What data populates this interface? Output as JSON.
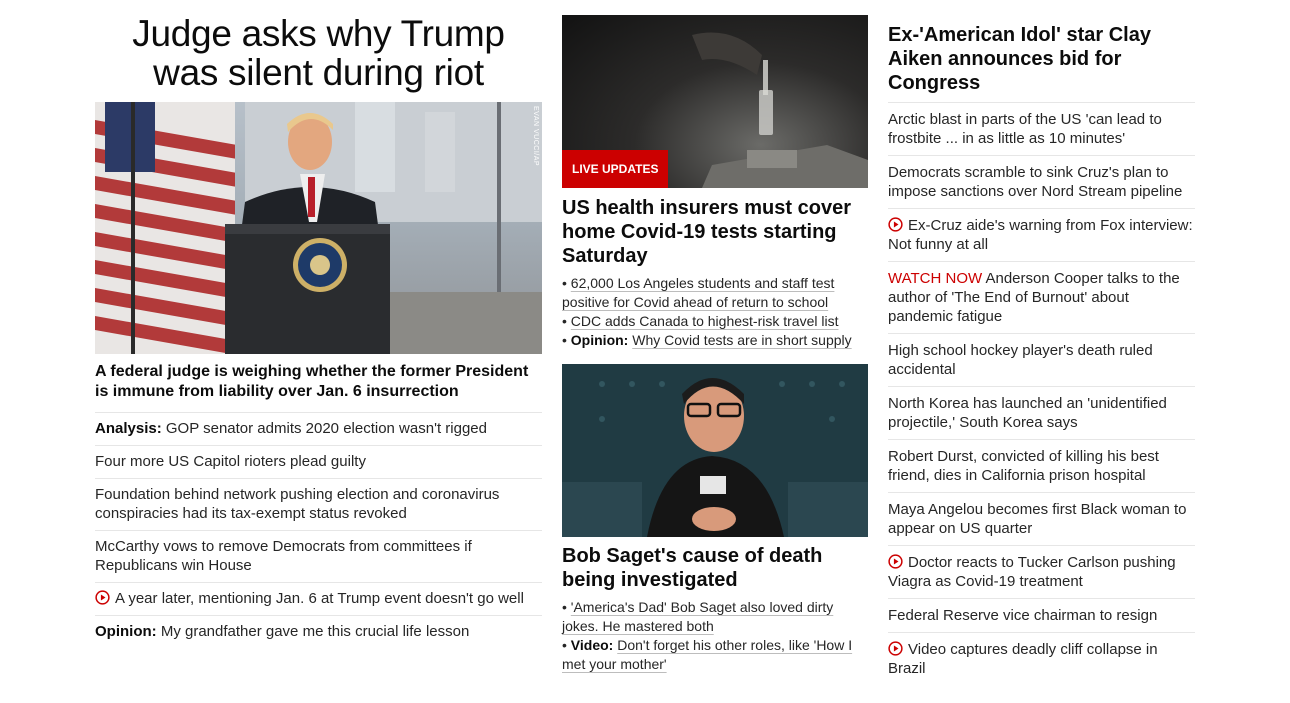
{
  "left": {
    "headline": "Judge asks why Trump was silent during riot",
    "image_credit": "EVAN VUCCI/AP",
    "subheadline": "A federal judge is weighing whether the former President is immune from liability over Jan. 6 insurrection",
    "items": [
      {
        "prefix": "Analysis:",
        "text": " GOP senator admits 2020 election wasn't rigged"
      },
      {
        "text": "Four more US Capitol rioters plead guilty"
      },
      {
        "text": "Foundation behind network pushing election and coronavirus conspiracies had its tax-exempt status revoked"
      },
      {
        "text": "McCarthy vows to remove Democrats from committees if Republicans win House"
      },
      {
        "video": true,
        "text": "A year later, mentioning Jan. 6 at Trump event doesn't go well"
      },
      {
        "prefix": "Opinion:",
        "text": " My grandfather gave me this crucial life lesson"
      }
    ]
  },
  "middle": {
    "story1": {
      "badge": "LIVE UPDATES",
      "headline": "US health insurers must cover home Covid-19 tests starting Saturday",
      "bullets": [
        {
          "text": "62,000 Los Angeles students and staff test positive for Covid ahead of return to school"
        },
        {
          "text": "CDC adds Canada to highest-risk travel list"
        },
        {
          "prefix": "Opinion:",
          "text": "Why Covid tests are in short supply"
        }
      ]
    },
    "story2": {
      "headline": "Bob Saget's cause of death being investigated",
      "bullets": [
        {
          "text": "'America's Dad' Bob Saget also loved dirty jokes. He mastered both"
        },
        {
          "prefix": "Video:",
          "text": "Don't forget his other roles, like 'How I met your mother'"
        }
      ]
    }
  },
  "right": {
    "headline": "Ex-'American Idol' star Clay Aiken announces bid for Congress",
    "items": [
      {
        "text": "Arctic blast in parts of the US 'can lead to frostbite ... in as little as 10 minutes'"
      },
      {
        "text": "Democrats scramble to sink Cruz's plan to impose sanctions over Nord Stream pipeline"
      },
      {
        "video": true,
        "text": "Ex-Cruz aide's warning from Fox interview: Not funny at all"
      },
      {
        "watch": "WATCH NOW",
        "text": " Anderson Cooper talks to the author of 'The End of Burnout' about pandemic fatigue"
      },
      {
        "text": "High school hockey player's death ruled accidental"
      },
      {
        "text": "North Korea has launched an 'unidentified projectile,' South Korea says"
      },
      {
        "text": "Robert Durst, convicted of killing his best friend, dies in California prison hospital"
      },
      {
        "text": "Maya Angelou becomes first Black woman to appear on US quarter"
      },
      {
        "video": true,
        "text": "Doctor reacts to Tucker Carlson pushing Viagra as Covid-19 treatment"
      },
      {
        "text": "Federal Reserve vice chairman to resign"
      },
      {
        "video": true,
        "text": "Video captures deadly cliff collapse in Brazil"
      }
    ]
  },
  "colors": {
    "accent_red": "#cc0000",
    "text": "#262626",
    "divider": "#e6e6e6"
  },
  "icons": {
    "video": "play-circle-icon"
  }
}
